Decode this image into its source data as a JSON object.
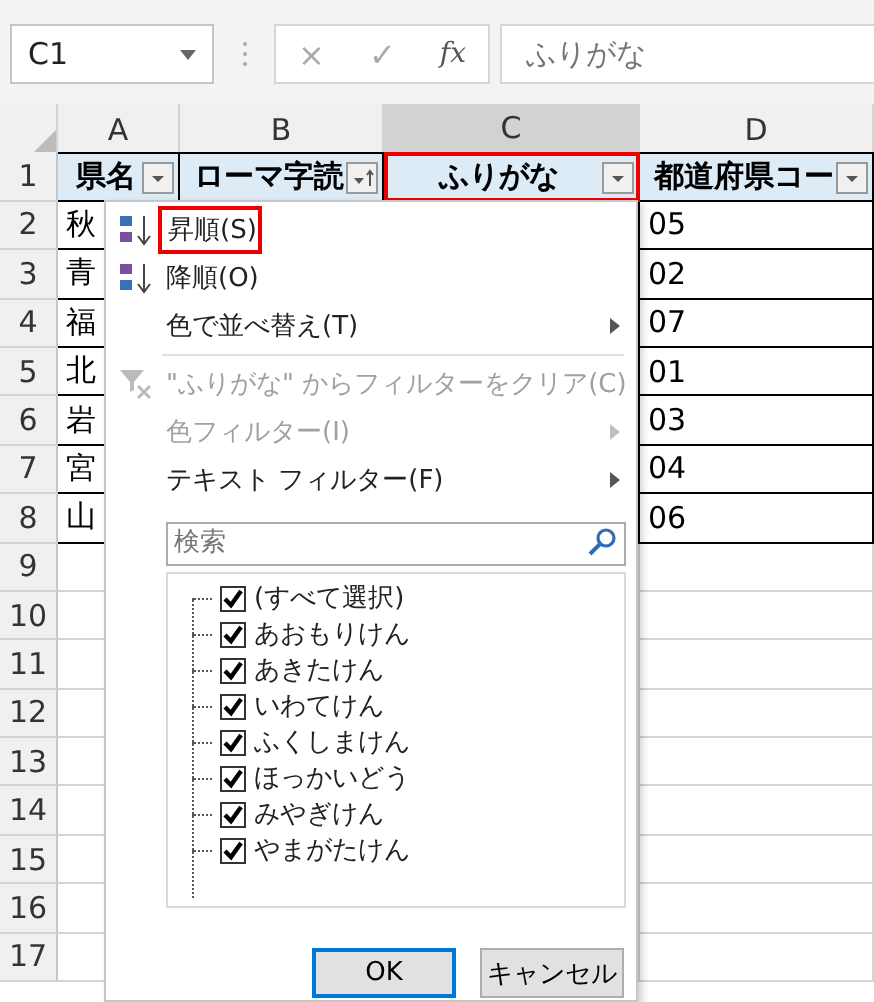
{
  "toolbar": {
    "name_box": "C1",
    "buttons": [
      "×",
      "✓",
      "fx"
    ],
    "formula": "ふりがな"
  },
  "columns": [
    {
      "label": "A",
      "selected": false
    },
    {
      "label": "B",
      "selected": false
    },
    {
      "label": "C",
      "selected": true
    },
    {
      "label": "D",
      "selected": false
    }
  ],
  "header_row": {
    "number": "1",
    "cells": [
      {
        "text": "県名",
        "sorted": false,
        "selected": false
      },
      {
        "text": "ローマ字読",
        "sorted": true,
        "selected": false
      },
      {
        "text": "ふりがな",
        "sorted": false,
        "selected": true
      },
      {
        "text": "都道府県コー",
        "sorted": false,
        "selected": false
      }
    ]
  },
  "rows": [
    {
      "number": "2",
      "name": "秋",
      "code": "05"
    },
    {
      "number": "3",
      "name": "青",
      "code": "02"
    },
    {
      "number": "4",
      "name": "福",
      "code": "07"
    },
    {
      "number": "5",
      "name": "北",
      "code": "01"
    },
    {
      "number": "6",
      "name": "岩",
      "code": "03"
    },
    {
      "number": "7",
      "name": "宮",
      "code": "04"
    },
    {
      "number": "8",
      "name": "山",
      "code": "06"
    },
    {
      "number": "9"
    },
    {
      "number": "10"
    },
    {
      "number": "11"
    },
    {
      "number": "12"
    },
    {
      "number": "13"
    },
    {
      "number": "14"
    },
    {
      "number": "15"
    },
    {
      "number": "16"
    },
    {
      "number": "17"
    }
  ],
  "filter_menu": {
    "items": [
      {
        "kind": "ascending",
        "label": "昇順(S)",
        "disabled": false,
        "highlighted": true
      },
      {
        "kind": "descending",
        "label": "降順(O)",
        "disabled": false,
        "highlighted": false
      },
      {
        "kind": "submenu",
        "label": "色で並べ替え(T)",
        "disabled": false,
        "highlighted": false
      },
      {
        "kind": "separator"
      },
      {
        "kind": "clear",
        "label": "\"ふりがな\" からフィルターをクリア(C)",
        "disabled": true,
        "highlighted": false
      },
      {
        "kind": "submenu",
        "label": "色フィルター(I)",
        "disabled": true,
        "highlighted": false
      },
      {
        "kind": "submenu",
        "label": "テキスト フィルター(F)",
        "disabled": false,
        "highlighted": false
      }
    ],
    "search": {
      "placeholder": "検索"
    },
    "values": [
      {
        "label": "(すべて選択)",
        "checked": true
      },
      {
        "label": "あおもりけん",
        "checked": true
      },
      {
        "label": "あきたけん",
        "checked": true
      },
      {
        "label": "いわてけん",
        "checked": true
      },
      {
        "label": "ふくしまけん",
        "checked": true
      },
      {
        "label": "ほっかいどう",
        "checked": true
      },
      {
        "label": "みやぎけん",
        "checked": true
      },
      {
        "label": "やまがたけん",
        "checked": true
      }
    ],
    "buttons": [
      {
        "label": "OK",
        "selected": true
      },
      {
        "label": "キャンセル",
        "selected": false
      }
    ]
  }
}
